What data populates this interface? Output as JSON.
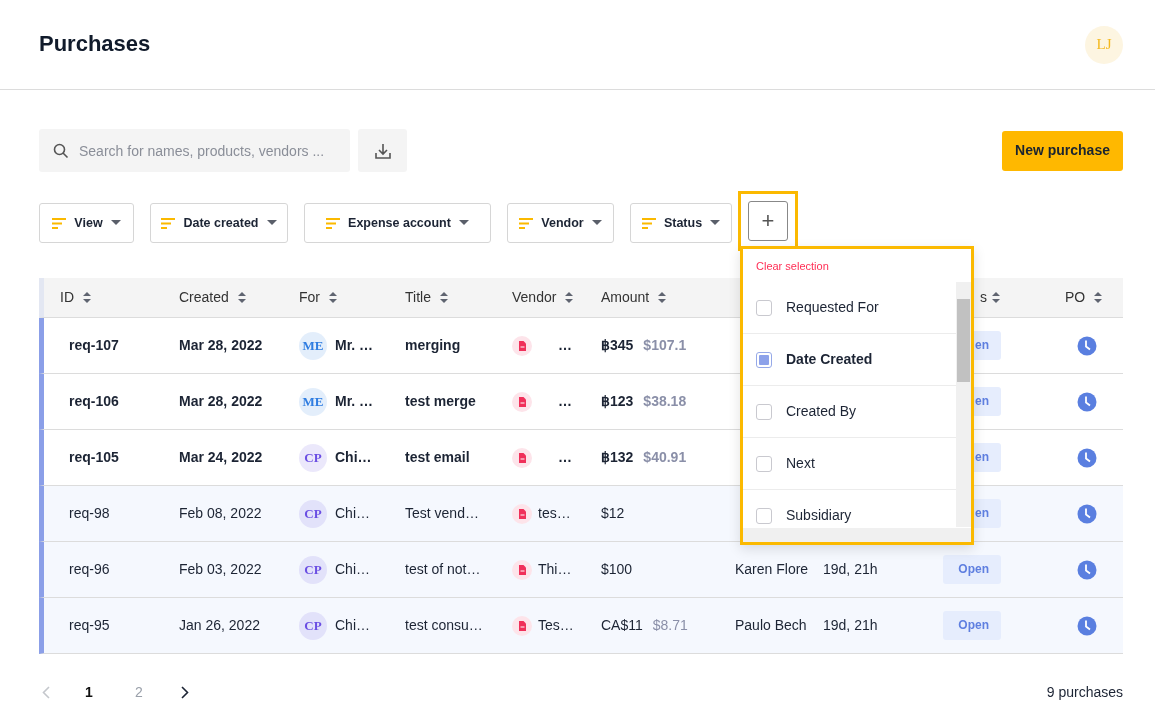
{
  "header": {
    "title": "Purchases",
    "avatar_initials": "LJ"
  },
  "search": {
    "placeholder": "Search for names, products, vendors ..."
  },
  "new_button": "New purchase",
  "filters": [
    {
      "label": "View"
    },
    {
      "label": "Date created"
    },
    {
      "label": "Expense account"
    },
    {
      "label": "Vendor"
    },
    {
      "label": "Status"
    }
  ],
  "add_filter": {
    "label": "+",
    "highlighted": true
  },
  "table": {
    "columns": [
      {
        "label": "ID",
        "sortable": true
      },
      {
        "label": "Created",
        "sortable": true
      },
      {
        "label": "For",
        "sortable": true
      },
      {
        "label": "Title",
        "sortable": true
      },
      {
        "label": "Vendor",
        "sortable": true
      },
      {
        "label": "Amount",
        "sortable": true
      },
      {
        "label": "s",
        "sortable": true
      },
      {
        "label": "PO",
        "sortable": true
      }
    ],
    "rows": [
      {
        "id": "req-107",
        "created": "Mar 28, 2022",
        "unread": true,
        "for": {
          "initials": "ME",
          "name": "Mr. …",
          "color": "#2f7de1"
        },
        "title": "merging",
        "vendor": "…",
        "amount": "฿345",
        "amount_converted": "$107.1",
        "status": "en"
      },
      {
        "id": "req-106",
        "created": "Mar 28, 2022",
        "unread": true,
        "for": {
          "initials": "ME",
          "name": "Mr. …",
          "color": "#2f7de1"
        },
        "title": "test merge",
        "vendor": "…",
        "amount": "฿123",
        "amount_converted": "$38.18",
        "status": "en"
      },
      {
        "id": "req-105",
        "created": "Mar 24, 2022",
        "unread": true,
        "for": {
          "initials": "CP",
          "name": "Chi…",
          "color": "#6b4fe3"
        },
        "title": "test email",
        "vendor": "…",
        "amount": "฿132",
        "amount_converted": "$40.91",
        "status": "en"
      },
      {
        "id": "req-98",
        "created": "Feb 08, 2022",
        "unread": false,
        "for": {
          "initials": "CP",
          "name": "Chi…",
          "color": "#6b4fe3"
        },
        "title": "Test vend…",
        "vendor": "tes…",
        "amount": "$12",
        "status": "en"
      },
      {
        "id": "req-96",
        "created": "Feb 03, 2022",
        "unread": false,
        "for": {
          "initials": "CP",
          "name": "Chi…",
          "color": "#6b4fe3"
        },
        "title": "test of not…",
        "vendor": "Thi…",
        "amount": "$100",
        "column_7": "Karen Flore",
        "column_8": "19d, 21h",
        "status": "Open"
      },
      {
        "id": "req-95",
        "created": "Jan 26, 2022",
        "unread": false,
        "for": {
          "initials": "CP",
          "name": "Chi…",
          "color": "#6b4fe3"
        },
        "title": "test consu…",
        "vendor": "Tes…",
        "amount": "CA$11",
        "amount_converted": "$8.71",
        "column_7": "Paulo Bech",
        "column_8": "19d, 21h",
        "status": "Open"
      }
    ]
  },
  "dropdown": {
    "clear": "Clear selection",
    "options": [
      {
        "label": "Requested For",
        "checked": false
      },
      {
        "label": "Date Created",
        "checked": true
      },
      {
        "label": "Created By",
        "checked": false
      },
      {
        "label": "Next",
        "checked": false
      },
      {
        "label": "Subsidiary",
        "checked": false
      }
    ]
  },
  "pagination": {
    "prev_disabled": true,
    "next_disabled": false,
    "pages": [
      {
        "label": "1",
        "selected": true
      },
      {
        "label": "2",
        "selected": false
      }
    ]
  },
  "total": "9 purchases"
}
